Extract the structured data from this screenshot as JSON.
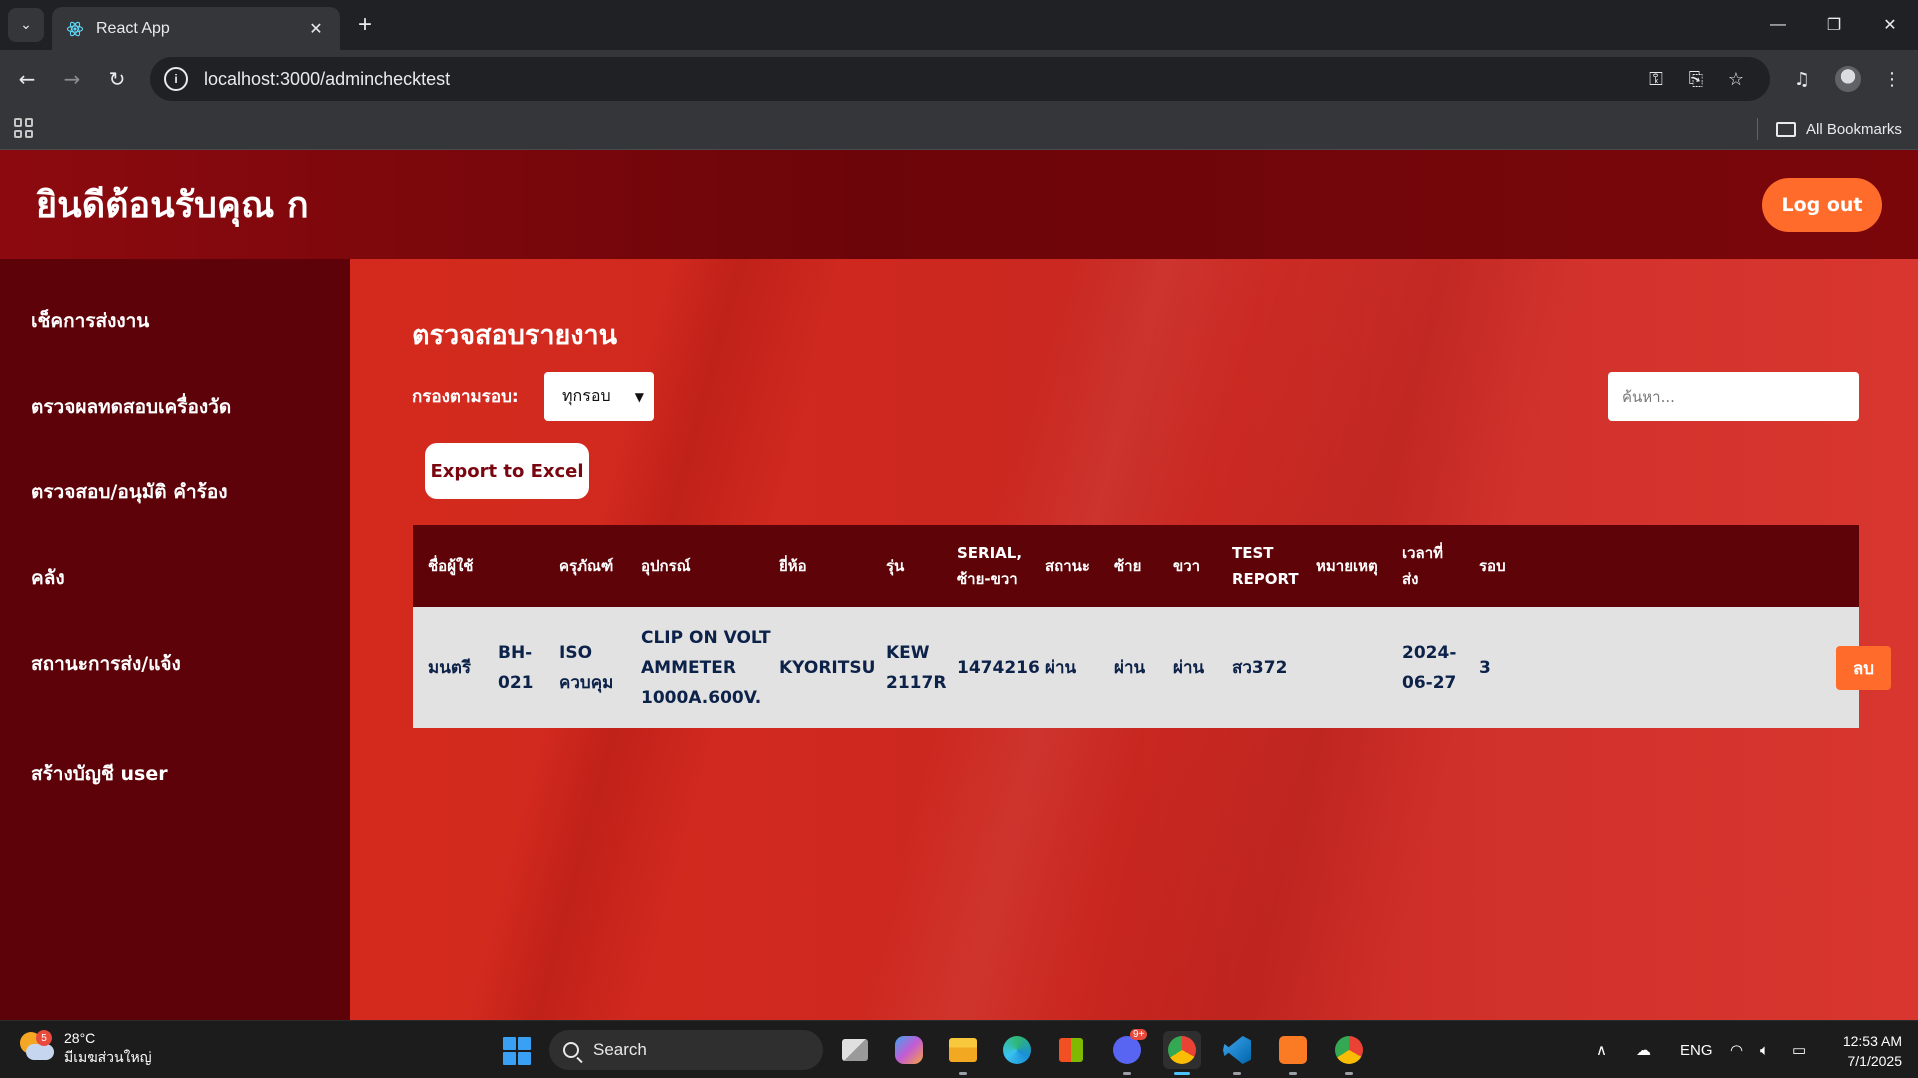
{
  "browser": {
    "tab_title": "React App",
    "url": "localhost:3000/adminchecktest",
    "bookmarks_label": "All Bookmarks"
  },
  "header": {
    "welcome": "ยินดีต้อนรับคุณ ก",
    "logout_label": "Log out"
  },
  "sidebar": {
    "items": [
      {
        "label": "เช็คการส่งงาน"
      },
      {
        "label": "ตรวจผลทดสอบเครื่องวัด"
      },
      {
        "label": "ตรวจสอบ/อนุมัติ คำร้อง"
      },
      {
        "label": "คลัง"
      },
      {
        "label": "สถานะการส่ง/แจ้ง"
      },
      {
        "label": "สร้างบัญชี user"
      }
    ]
  },
  "main": {
    "title": "ตรวจสอบรายงาน",
    "filter_label": "กรองตามรอบ:",
    "filter_value": "ทุกรอบ",
    "search_placeholder": "ค้นหา...",
    "export_label": "Export to Excel",
    "table": {
      "headers": {
        "user": "ชื่อผู้ใช้",
        "category": "ครุภัณฑ์",
        "equipment": "อุปกรณ์",
        "brand": "ยี่ห้อ",
        "model": "รุ่น",
        "serial_1": "SERIAL,",
        "serial_2": "ซ้าย-ขวา",
        "status": "สถานะ",
        "left": "ซ้าย",
        "right": "ขวา",
        "test_1": "TEST",
        "test_2": "REPORT",
        "note": "หมายเหตุ",
        "time_1": "เวลาที่",
        "time_2": "ส่ง",
        "round": "รอบ"
      },
      "rows": [
        {
          "user": "มนตรี",
          "code_1": "BH-",
          "code_2": "021",
          "category_1": "ISO",
          "category_2": "ควบคุม",
          "equipment_1": "CLIP ON VOLT",
          "equipment_2": "AMMETER",
          "equipment_3": "1000A.600V.",
          "brand": "KYORITSU",
          "model_1": "KEW",
          "model_2": "2117R",
          "serial": "1474216",
          "status": "ผ่าน",
          "left": "ผ่าน",
          "right": "ผ่าน",
          "test_report": "สว372",
          "note": "",
          "time_1": "2024-",
          "time_2": "06-27",
          "round": "3",
          "delete_label": "ลบ"
        }
      ]
    }
  },
  "taskbar": {
    "weather_badge": "5",
    "temperature": "28°C",
    "weather_desc": "มีเมฆส่วนใหญ่",
    "search_label": "Search",
    "language": "ENG",
    "time": "12:53 AM",
    "date": "7/1/2025",
    "discord_badge": "9+"
  }
}
